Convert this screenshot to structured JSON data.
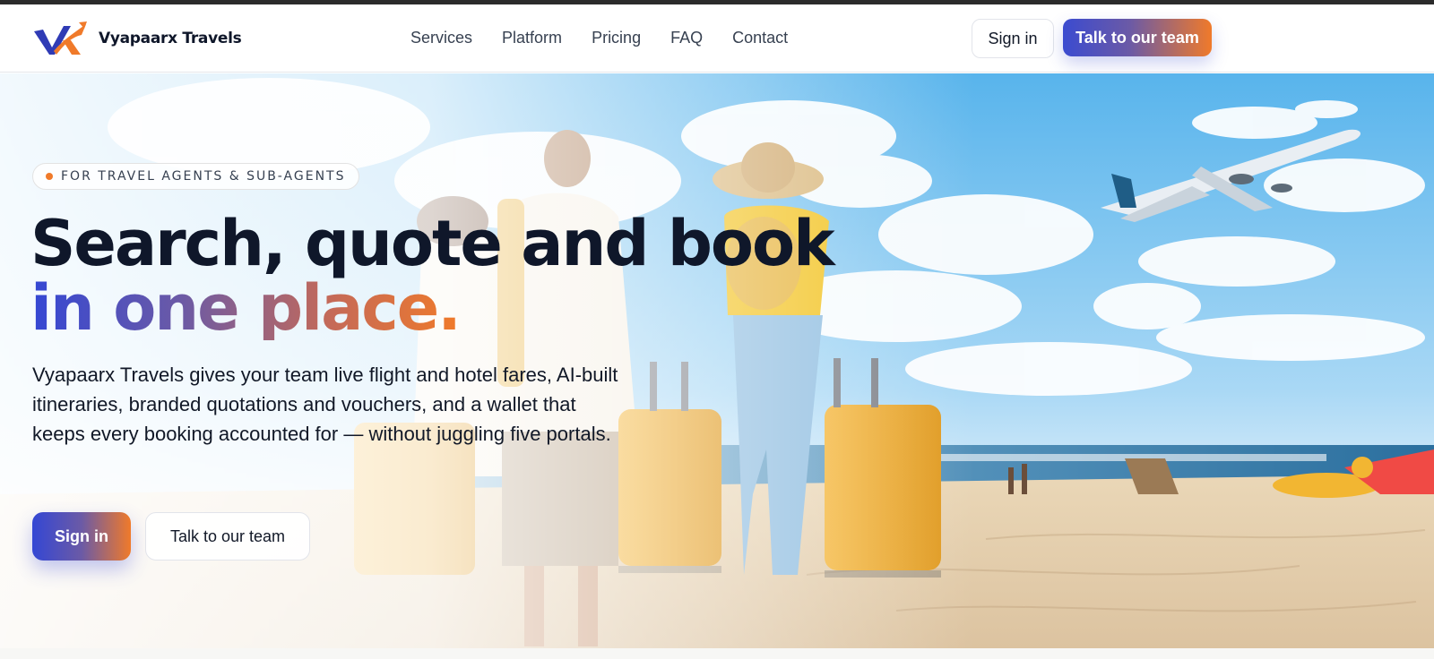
{
  "nav": {
    "brand_name": "Vyapaarx Travels",
    "links": [
      "Services",
      "Platform",
      "Pricing",
      "FAQ",
      "Contact"
    ],
    "sign_in_label": "Sign in",
    "cta_label": "Talk to our team"
  },
  "hero": {
    "eyebrow": "FOR TRAVEL AGENTS & SUB-AGENTS",
    "headline_line1": "Search, quote and book",
    "headline_line2": "in one place.",
    "lead": "Vyapaarx Travels gives your team live flight and hotel fares, AI-built itineraries, branded quotations and vouchers, and a wallet that keeps every booking accounted for — without juggling five portals.",
    "sign_in_label": "Sign in",
    "cta_label": "Talk to our team"
  },
  "colors": {
    "brand_blue": "#3447d4",
    "brand_orange": "#f07a2a",
    "text_dark": "#0f172a"
  }
}
